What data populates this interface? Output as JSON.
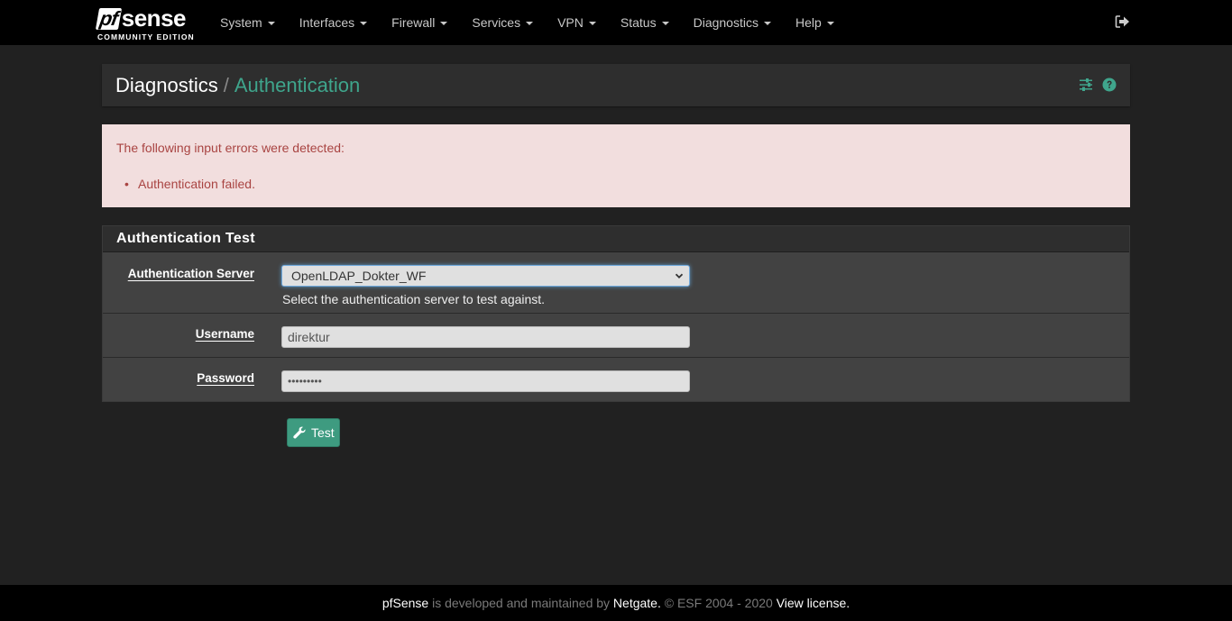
{
  "navbar": {
    "brand": {
      "logo_pf": "pf",
      "logo_sense": "sense",
      "edition": "COMMUNITY EDITION"
    },
    "menu": [
      {
        "label": "System"
      },
      {
        "label": "Interfaces"
      },
      {
        "label": "Firewall"
      },
      {
        "label": "Services"
      },
      {
        "label": "VPN"
      },
      {
        "label": "Status"
      },
      {
        "label": "Diagnostics"
      },
      {
        "label": "Help"
      }
    ],
    "logout_icon": "sign-out-icon"
  },
  "breadcrumb": {
    "parent": "Diagnostics",
    "separator": "/",
    "current": "Authentication",
    "icons": [
      "sliders-icon",
      "question-circle-icon"
    ]
  },
  "alert": {
    "title": "The following input errors were detected:",
    "errors": [
      "Authentication failed."
    ]
  },
  "panel": {
    "title": "Authentication Test",
    "fields": {
      "server": {
        "label": "Authentication Server",
        "selected": "OpenLDAP_Dokter_WF",
        "help": "Select the authentication server to test against."
      },
      "username": {
        "label": "Username",
        "value": "direktur"
      },
      "password": {
        "label": "Password",
        "value": "•••••••••"
      }
    }
  },
  "actions": {
    "test_label": "Test"
  },
  "footer": {
    "product": "pfSense",
    "text1": " is developed and maintained by ",
    "company": "Netgate.",
    "text2": " © ESF 2004 - 2020 ",
    "license_link": "View license."
  },
  "colors": {
    "accent": "#3fa58c",
    "alert_bg": "#f2dede",
    "alert_text": "#a94442",
    "button": "#3e9b80"
  }
}
